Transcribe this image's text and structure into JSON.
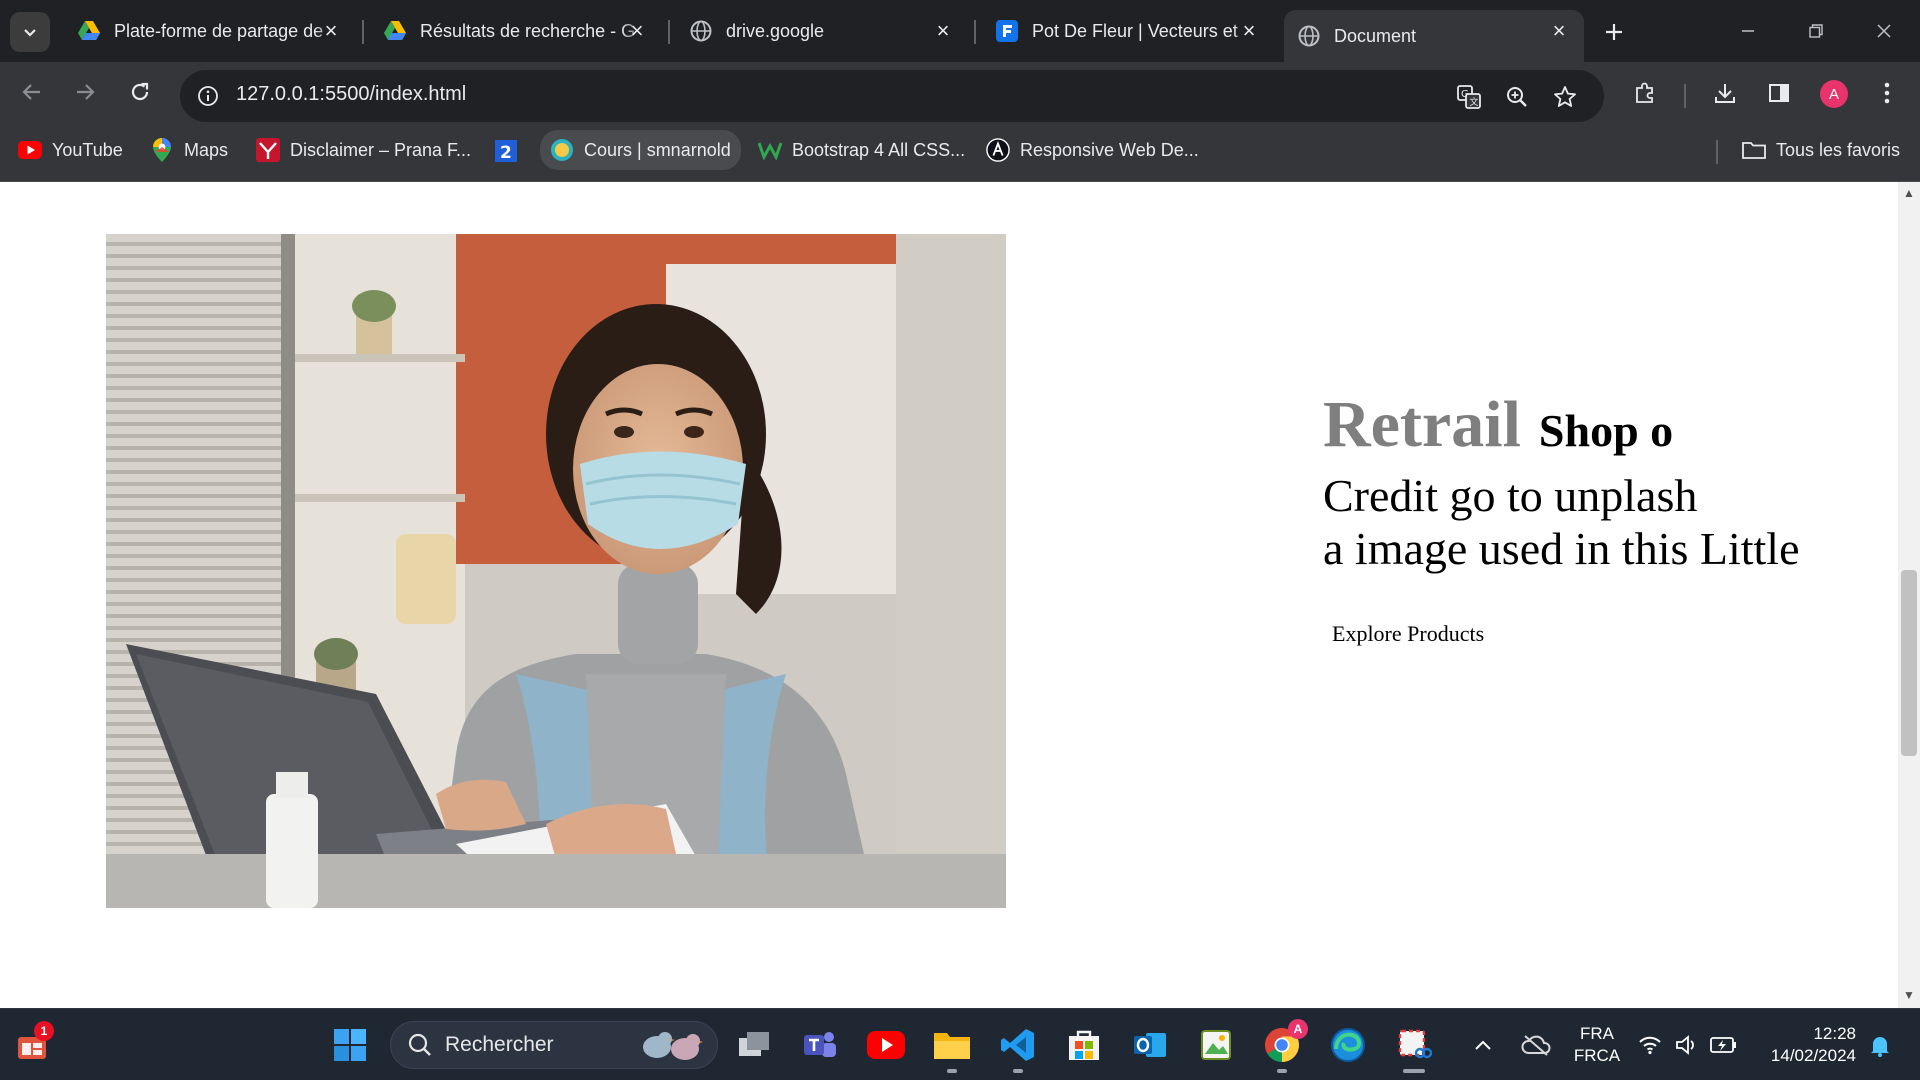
{
  "browser": {
    "tabs": [
      {
        "title": "Plate-forme de partage de",
        "favicon": "google-drive-icon"
      },
      {
        "title": "Résultats de recherche - G",
        "favicon": "google-drive-icon"
      },
      {
        "title": "drive.google",
        "favicon": "globe-icon"
      },
      {
        "title": "Pot De Fleur | Vecteurs et",
        "favicon": "freepik-icon"
      },
      {
        "title": "Document",
        "favicon": "globe-icon",
        "active": true
      }
    ],
    "url": "127.0.0.1:5500/index.html",
    "profile_initial": "A",
    "bookmarks": [
      {
        "label": "YouTube",
        "icon": "youtube-icon"
      },
      {
        "label": "Maps",
        "icon": "maps-pin-icon"
      },
      {
        "label": "Disclaimer – Prana F...",
        "icon": "prana-icon"
      },
      {
        "label": "",
        "icon": "number-2-icon"
      },
      {
        "label": "Cours | smnarnold",
        "icon": "smnarnold-icon"
      },
      {
        "label": "Bootstrap 4 All CSS...",
        "icon": "w-icon"
      },
      {
        "label": "Responsive Web De...",
        "icon": "angular-icon"
      }
    ],
    "all_bookmarks_label": "Tous les favoris"
  },
  "page": {
    "brand": "Retrail",
    "brand_sub": "Shop o",
    "credit_line_1": "Credit go to unplash",
    "credit_line_2": "a image used in this Little",
    "cta_label": "Explore Products",
    "hero_image_alt": "woman-with-mask-at-laptop"
  },
  "taskbar": {
    "search_placeholder": "Rechercher",
    "widget_badge": "1",
    "chrome_badge": "A",
    "language_line_1": "FRA",
    "language_line_2": "FRCA",
    "time": "12:28",
    "date": "14/02/2024"
  },
  "colors": {
    "tab_strip": "#202124",
    "toolbar": "#35363a",
    "brand_grey": "#7f7f7f",
    "taskbar": "#1f2733",
    "avatar": "#e8336d"
  }
}
